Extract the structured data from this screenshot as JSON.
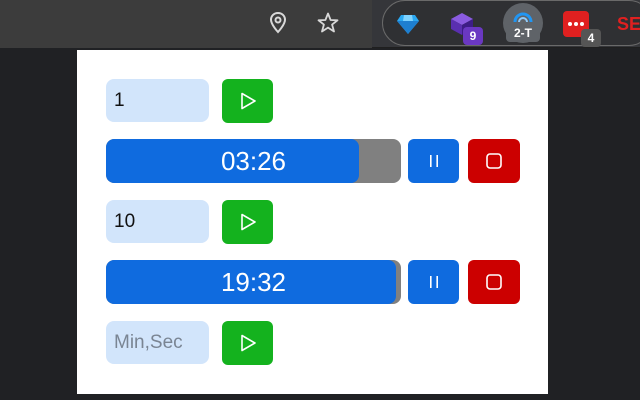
{
  "browser": {
    "extensions": [
      {
        "icon": "gem-icon",
        "color": "#2aa8f2",
        "badge": ""
      },
      {
        "icon": "purple-cube-icon",
        "color": "#6a38c2",
        "badge": "9",
        "badge_color": "#6a38c2"
      },
      {
        "icon": "timer-extension-icon",
        "color": "#2196f3",
        "badge": "2-T",
        "badge_color": "#5f6368"
      },
      {
        "icon": "red-app-icon",
        "color": "#e02020",
        "badge": "4",
        "badge_color": "#555555"
      },
      {
        "icon": "se-logo-icon",
        "label": "SE",
        "color": "#e02020"
      }
    ]
  },
  "popup": {
    "timers": [
      {
        "input_value": "1",
        "display": "03:26",
        "progress": 0.856
      },
      {
        "input_value": "10",
        "display": "19:32",
        "progress": 0.983
      }
    ],
    "new_timer": {
      "placeholder": "Min,Sec"
    }
  },
  "colors": {
    "play": "#14b21e",
    "progress_fill": "#0f6bdf",
    "progress_track": "#808080",
    "pause": "#0f6bdf",
    "stop": "#cc0000",
    "input_bg": "#d2e5fb"
  }
}
